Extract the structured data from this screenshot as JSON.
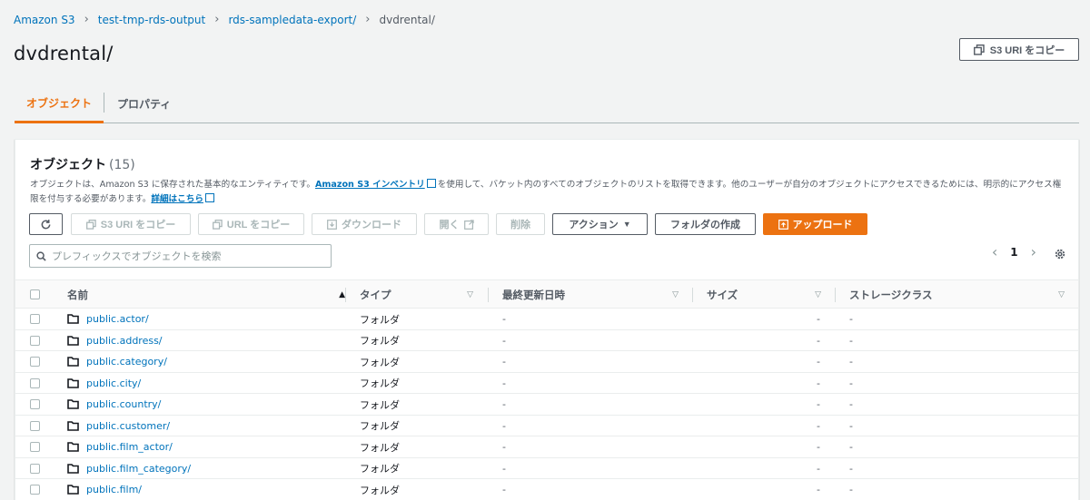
{
  "breadcrumb": {
    "items": [
      "Amazon S3",
      "test-tmp-rds-output",
      "rds-sampledata-export/"
    ],
    "current": "dvdrental/"
  },
  "page_title": "dvdrental/",
  "copy_uri_label": "S3 URI をコピー",
  "tabs": [
    {
      "label": "オブジェクト",
      "active": true
    },
    {
      "label": "プロパティ",
      "active": false
    }
  ],
  "panel": {
    "title": "オブジェクト",
    "count": "(15)",
    "desc_part1": "オブジェクトは、Amazon S3 に保存された基本的なエンティティです。",
    "desc_link1": "Amazon S3 インベントリ",
    "desc_part2": "を使用して、バケット内のすべてのオブジェクトのリストを取得できます。他のユーザーが自分のオブジェクトにアクセスできるためには、明示的にアクセス権限を付与する必要があります。",
    "desc_link2": "詳細はこちら"
  },
  "toolbar": {
    "copy_s3_uri": "S3 URI をコピー",
    "copy_url": "URL をコピー",
    "download": "ダウンロード",
    "open": "開く",
    "delete": "削除",
    "actions": "アクション",
    "create_folder": "フォルダの作成",
    "upload": "アップロード"
  },
  "search": {
    "placeholder": "プレフィックスでオブジェクトを検索"
  },
  "pagination": {
    "page": "1"
  },
  "table": {
    "columns": [
      "名前",
      "タイプ",
      "最終更新日時",
      "サイズ",
      "ストレージクラス"
    ],
    "rows": [
      {
        "name": "public.actor/",
        "type": "フォルダ",
        "modified": "-",
        "size": "-",
        "storage": "-"
      },
      {
        "name": "public.address/",
        "type": "フォルダ",
        "modified": "-",
        "size": "-",
        "storage": "-"
      },
      {
        "name": "public.category/",
        "type": "フォルダ",
        "modified": "-",
        "size": "-",
        "storage": "-"
      },
      {
        "name": "public.city/",
        "type": "フォルダ",
        "modified": "-",
        "size": "-",
        "storage": "-"
      },
      {
        "name": "public.country/",
        "type": "フォルダ",
        "modified": "-",
        "size": "-",
        "storage": "-"
      },
      {
        "name": "public.customer/",
        "type": "フォルダ",
        "modified": "-",
        "size": "-",
        "storage": "-"
      },
      {
        "name": "public.film_actor/",
        "type": "フォルダ",
        "modified": "-",
        "size": "-",
        "storage": "-"
      },
      {
        "name": "public.film_category/",
        "type": "フォルダ",
        "modified": "-",
        "size": "-",
        "storage": "-"
      },
      {
        "name": "public.film/",
        "type": "フォルダ",
        "modified": "-",
        "size": "-",
        "storage": "-"
      }
    ]
  },
  "colors": {
    "accent": "#ec7211",
    "link": "#0073bb",
    "text": "#16191f",
    "muted": "#545b64"
  }
}
